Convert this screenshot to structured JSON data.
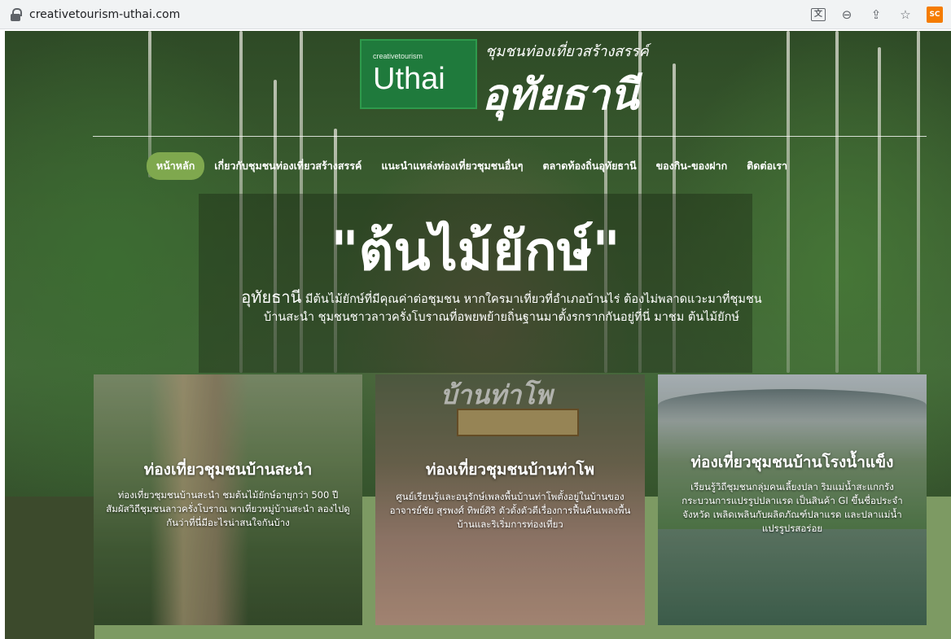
{
  "browser": {
    "url": "creativetourism-uthai.com",
    "icons": [
      "lock-icon",
      "translate-icon",
      "zoom-icon",
      "share-icon",
      "star-icon",
      "extension-icon"
    ],
    "extension_label": "SC"
  },
  "logo": {
    "small": "creativetourism",
    "big": "Uthai",
    "tagline": "ชุมชนท่องเที่ยวสร้างสรรค์",
    "thai": "อุทัยธานี"
  },
  "nav": {
    "items": [
      {
        "label": "หน้าหลัก",
        "active": true
      },
      {
        "label": "เกี่ยวกับชุมชนท่องเที่ยวสร้างสรรค์",
        "active": false
      },
      {
        "label": "แนะนำแหล่งท่องเที่ยวชุมชนอื่นๆ",
        "active": false
      },
      {
        "label": "ตลาดท้องถิ่นอุทัยธานี",
        "active": false
      },
      {
        "label": "ของกิน-ของฝาก",
        "active": false
      },
      {
        "label": "ติดต่อเรา",
        "active": false
      }
    ]
  },
  "hero": {
    "title": "\"ต้นไม้ยักษ์\"",
    "intro_lead": "อุทัยธานี",
    "intro_line1": " มีต้นไม้ยักษ์ที่มีคุณค่าต่อชุมชน หากใครมาเที่ยวที่อำเภอบ้านไร่ ต้องไม่พลาดแวะมาที่ชุมชน",
    "intro_line2": "บ้านสะนำ ชุมชนชาวลาวครั่งโบราณที่อพยพย้ายถิ่นฐานมาตั้งรกรากกันอยู่ที่นี่ มาชม ต้นไม้ยักษ์"
  },
  "cards": [
    {
      "title": "ท่องเที่ยวชุมชนบ้านสะนำ",
      "text": "ท่องเที่ยวชุมชนบ้านสะนำ ชมต้นไม้ยักษ์อายุกว่า 500 ปี สัมผัสวิถีชุมชนลาวครั่งโบราณ พาเที่ยวหมู่บ้านสะนำ ลองไปดูกันว่าที่นี่มีอะไรน่าสนใจกันบ้าง"
    },
    {
      "title": "ท่องเที่ยวชุมชนบ้านท่าโพ",
      "sign": "บ้านท่าโพ",
      "text": "ศูนย์เรียนรู้และอนุรักษ์เพลงพื้นบ้านท่าโพตั้งอยู่ในบ้านของ อาจารย์ชัย สุรพงศ์ ทิพย์ศิริ ตัวตั้งตัวตีเรื่องการฟื้นคืนเพลงพื้นบ้านและริเริ่มการท่องเที่ยว"
    },
    {
      "title": "ท่องเที่ยวชุมชนบ้านโรงน้ำแข็ง",
      "text": "เรียนรู้วิถีชุมชนกลุ่มคนเลี้ยงปลา ริมแม่น้ำสะแกกรัง กระบวนการแปรรูปปลาแรด เป็นสินค้า GI ขึ้นชื่อประจำจังหวัด เพลิดเพลินกับผลิตภัณฑ์ปลาแรด และปลาแม่น้ำแปรรูปรสอร่อย"
    }
  ],
  "colors": {
    "nav_active": "#7fa84e",
    "logo_green": "#1f7a3c",
    "band_green": "#7d9a63"
  }
}
